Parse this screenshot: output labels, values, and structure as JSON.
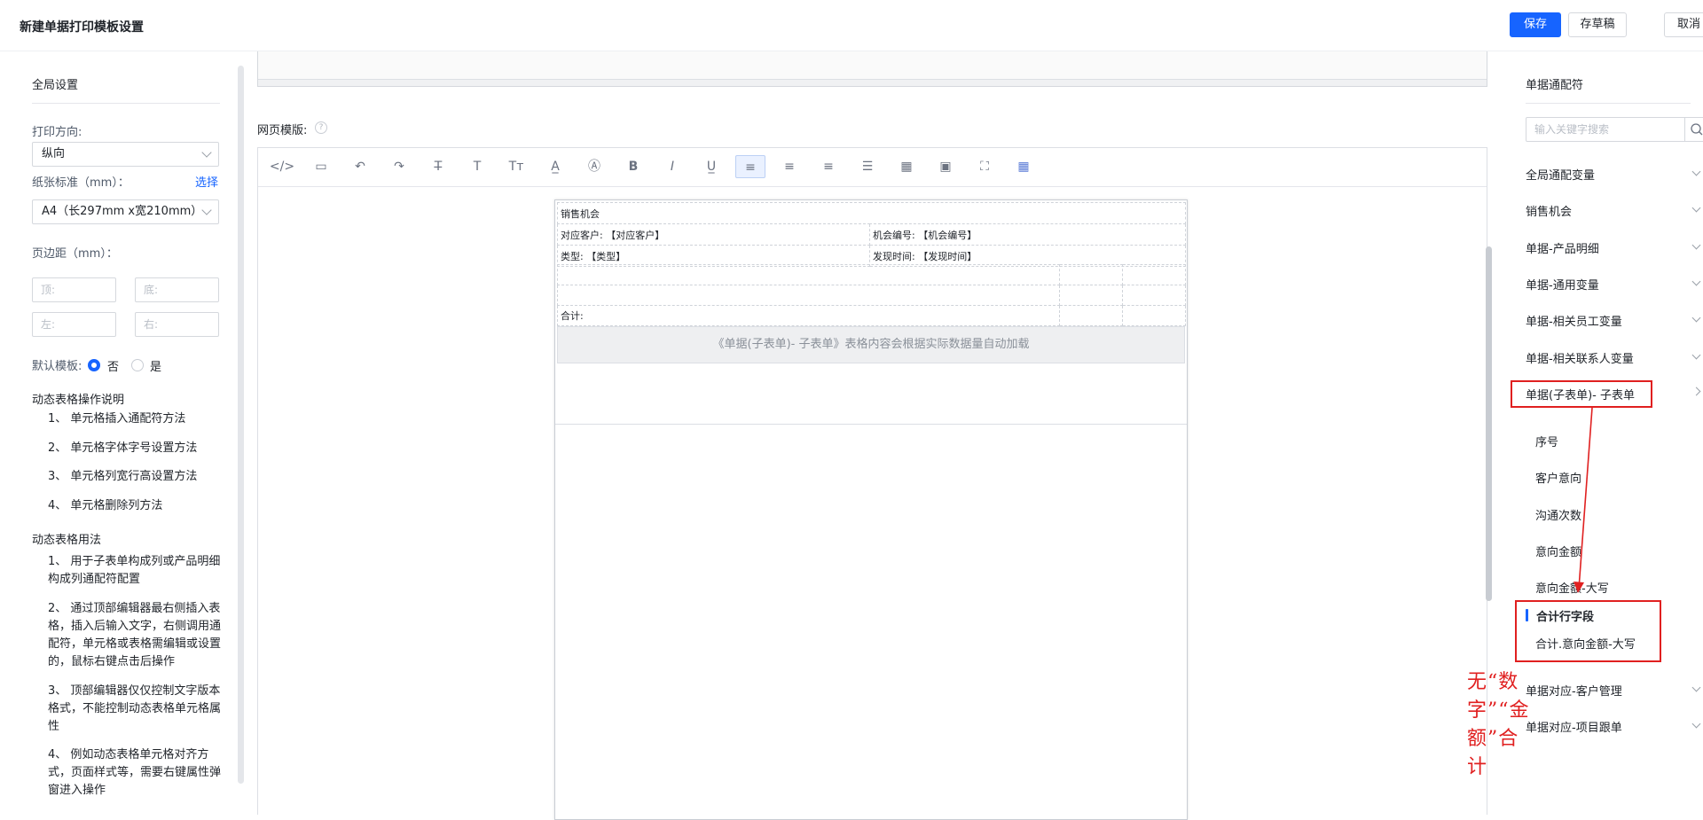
{
  "header": {
    "title": "新建单据打印模板设置",
    "save": "保存",
    "draft": "存草稿",
    "cancel": "取消"
  },
  "left": {
    "section_title": "全局设置",
    "print_direction_label": "打印方向:",
    "print_direction_value": "纵向",
    "paper_label": "纸张标准（mm）：",
    "paper_select_link": "选择",
    "paper_value": "A4（长297mm x宽210mm）",
    "margin_label": "页边距（mm）：",
    "margin_top": "顶:",
    "margin_bottom": "底:",
    "margin_left": "左:",
    "margin_right": "右:",
    "default_template_label": "默认模板:",
    "default_no": "否",
    "default_yes": "是",
    "ops_title": "动态表格操作说明",
    "ops": [
      "1、 单元格插入通配符方法",
      "2、 单元格字体字号设置方法",
      "3、 单元格列宽行高设置方法",
      "4、 单元格删除列方法"
    ],
    "usage_title": "动态表格用法",
    "usage": [
      "1、 用于子表单构成列或产品明细构成列通配符配置",
      "2、 通过顶部编辑器最右侧插入表格，插入后输入文字，右侧调用通配符，单元格或表格需编辑或设置的，鼠标右键点击后操作",
      "3、 顶部编辑器仅仅控制文字版本格式，不能控制动态表格单元格属性",
      "4、 例如动态表格单元格对齐方式，页面样式等，需要右键属性弹窗进入操作"
    ]
  },
  "center": {
    "web_template_label": "网页模版:",
    "help": "?",
    "toolbar": [
      "</>",
      "▭",
      "↶",
      "↷",
      "T̶",
      "T",
      "Tт",
      "A̲",
      "Ⓐ",
      "B",
      "I",
      "U̲",
      "≡",
      "≡",
      "≡",
      "☰",
      "▦",
      "▣",
      "⛶",
      "▦"
    ],
    "doc": {
      "title": "销售机会",
      "customer_label": "对应客户:",
      "customer_value": "【对应客户】",
      "opp_no_label": "机会编号:",
      "opp_no_value": "【机会编号】",
      "type_label": "类型:",
      "type_value": "【类型】",
      "found_label": "发现时间:",
      "found_value": "【发现时间】",
      "total_label": "合计:",
      "autoload": "《单据(子表单)- 子表单》表格内容会根据实际数据量自动加载"
    },
    "annotation": "无“数字”“金额”合计"
  },
  "right": {
    "section_title": "单据通配符",
    "search_placeholder": "输入关键字搜索",
    "groups": [
      "全局通配变量",
      "销售机会",
      "单据-产品明细",
      "单据-通用变量",
      "单据-相关员工变量",
      "单据-相关联系人变量",
      "单据(子表单)- 子表单"
    ],
    "sub_items": [
      "序号",
      "客户意向",
      "沟通次数",
      "意向金额",
      "意向金额-大写"
    ],
    "total_title": "合计行字段",
    "total_item": "合计.意向金额-大写",
    "bottom_groups": [
      "单据对应-客户管理",
      "单据对应-项目跟单"
    ]
  },
  "colors": {
    "primary": "#1664ff",
    "annotation": "#e02020"
  }
}
